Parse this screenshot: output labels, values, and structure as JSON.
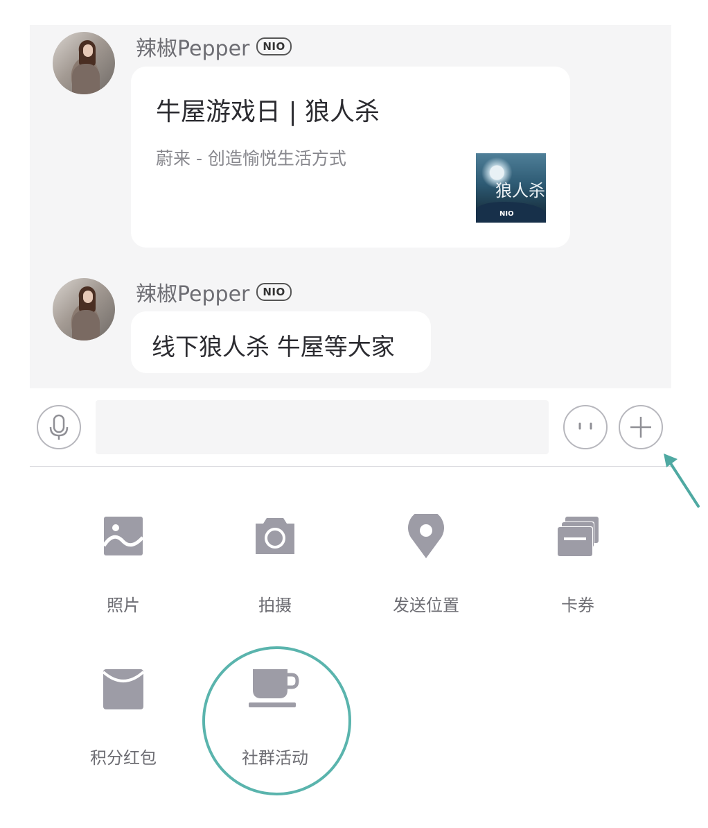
{
  "messages": [
    {
      "sender": "辣椒Pepper",
      "badge": "NIO",
      "card": {
        "title": "牛屋游戏日 | 狼人杀",
        "subtitle": "蔚来 - 创造愉悦生活方式",
        "thumb_text": "狼人杀",
        "thumb_brand": "NIO"
      }
    },
    {
      "sender": "辣椒Pepper",
      "badge": "NIO",
      "text": "线下狼人杀 牛屋等大家"
    }
  ],
  "input": {
    "voice_icon": "microphone-icon",
    "emoji_icon": "emoji-icon",
    "more_icon": "plus-icon"
  },
  "tools": [
    {
      "label": "照片",
      "icon": "image-icon"
    },
    {
      "label": "拍摄",
      "icon": "camera-icon"
    },
    {
      "label": "发送位置",
      "icon": "location-pin-icon"
    },
    {
      "label": "卡券",
      "icon": "card-stack-icon"
    },
    {
      "label": "积分红包",
      "icon": "red-packet-icon"
    },
    {
      "label": "社群活动",
      "icon": "coffee-cup-icon"
    }
  ],
  "colors": {
    "icon": "#9d9ca6",
    "label": "#6d6d73",
    "highlight": "#5ab4ad",
    "chat_bg": "#f5f5f6"
  }
}
